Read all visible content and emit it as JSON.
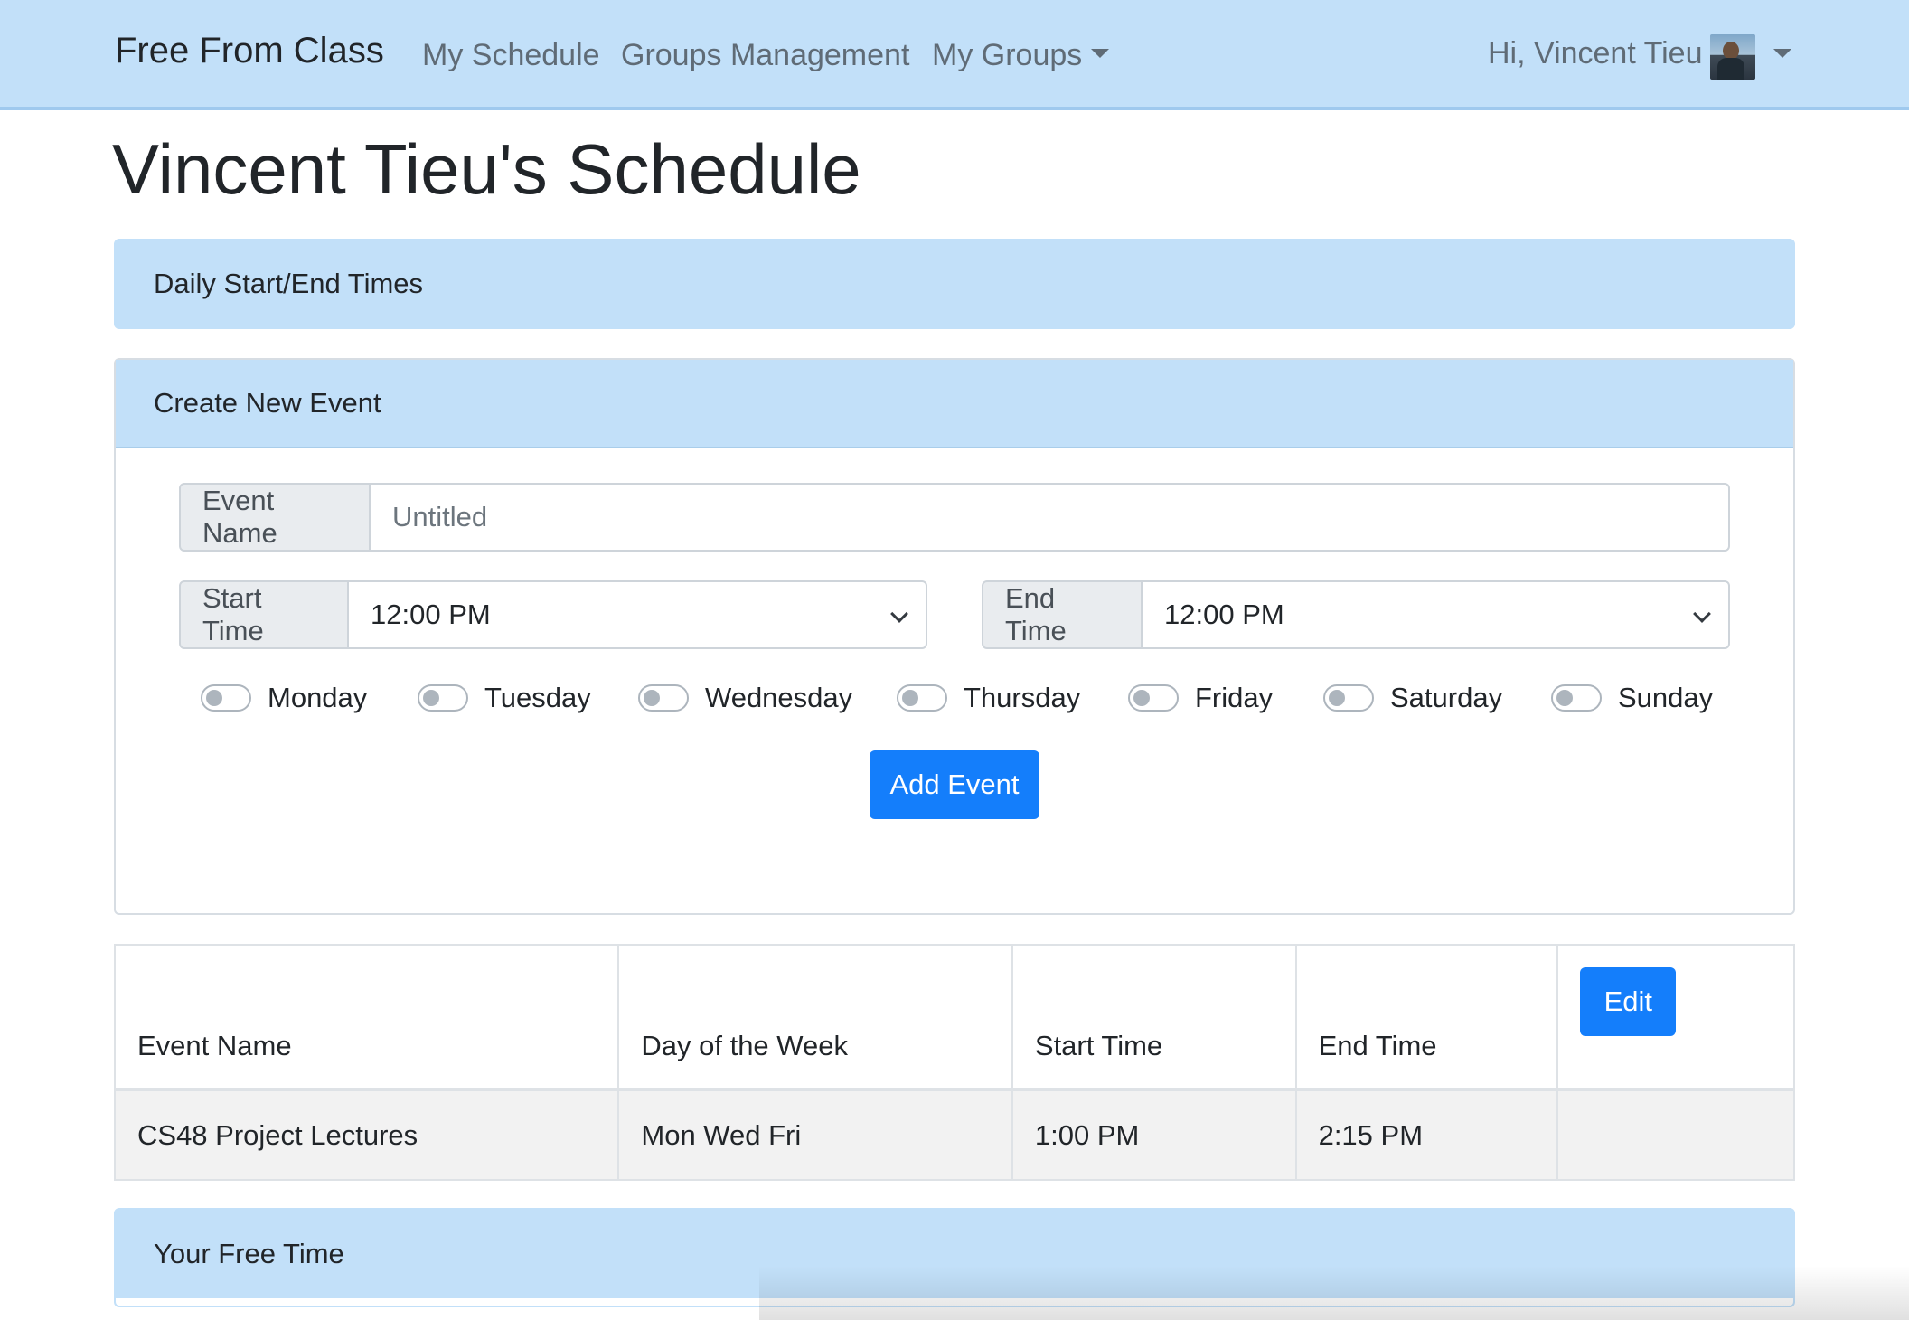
{
  "navbar": {
    "brand": "Free From Class",
    "links": [
      "My Schedule",
      "Groups Management",
      "My Groups"
    ],
    "greeting": "Hi, Vincent Tieu"
  },
  "page_title": "Vincent Tieu's Schedule",
  "daily_card": {
    "header": "Daily Start/End Times"
  },
  "create_card": {
    "header": "Create New Event",
    "event_name_label": "Event Name",
    "event_name_placeholder": "Untitled",
    "start_label": "Start Time",
    "start_value": "12:00 PM",
    "end_label": "End Time",
    "end_value": "12:00 PM",
    "days": [
      "Monday",
      "Tuesday",
      "Wednesday",
      "Thursday",
      "Friday",
      "Saturday",
      "Sunday"
    ],
    "add_button": "Add Event"
  },
  "events_table": {
    "headers": [
      "Event Name",
      "Day of the Week",
      "Start Time",
      "End Time"
    ],
    "edit_button": "Edit",
    "rows": [
      [
        "CS48 Project Lectures",
        "Mon Wed Fri",
        "1:00 PM",
        "2:15 PM"
      ]
    ]
  },
  "free_card": {
    "header": "Your Free Time"
  },
  "colors": {
    "navbar_bg": "#c2e0f9",
    "primary_button": "#147efb"
  }
}
